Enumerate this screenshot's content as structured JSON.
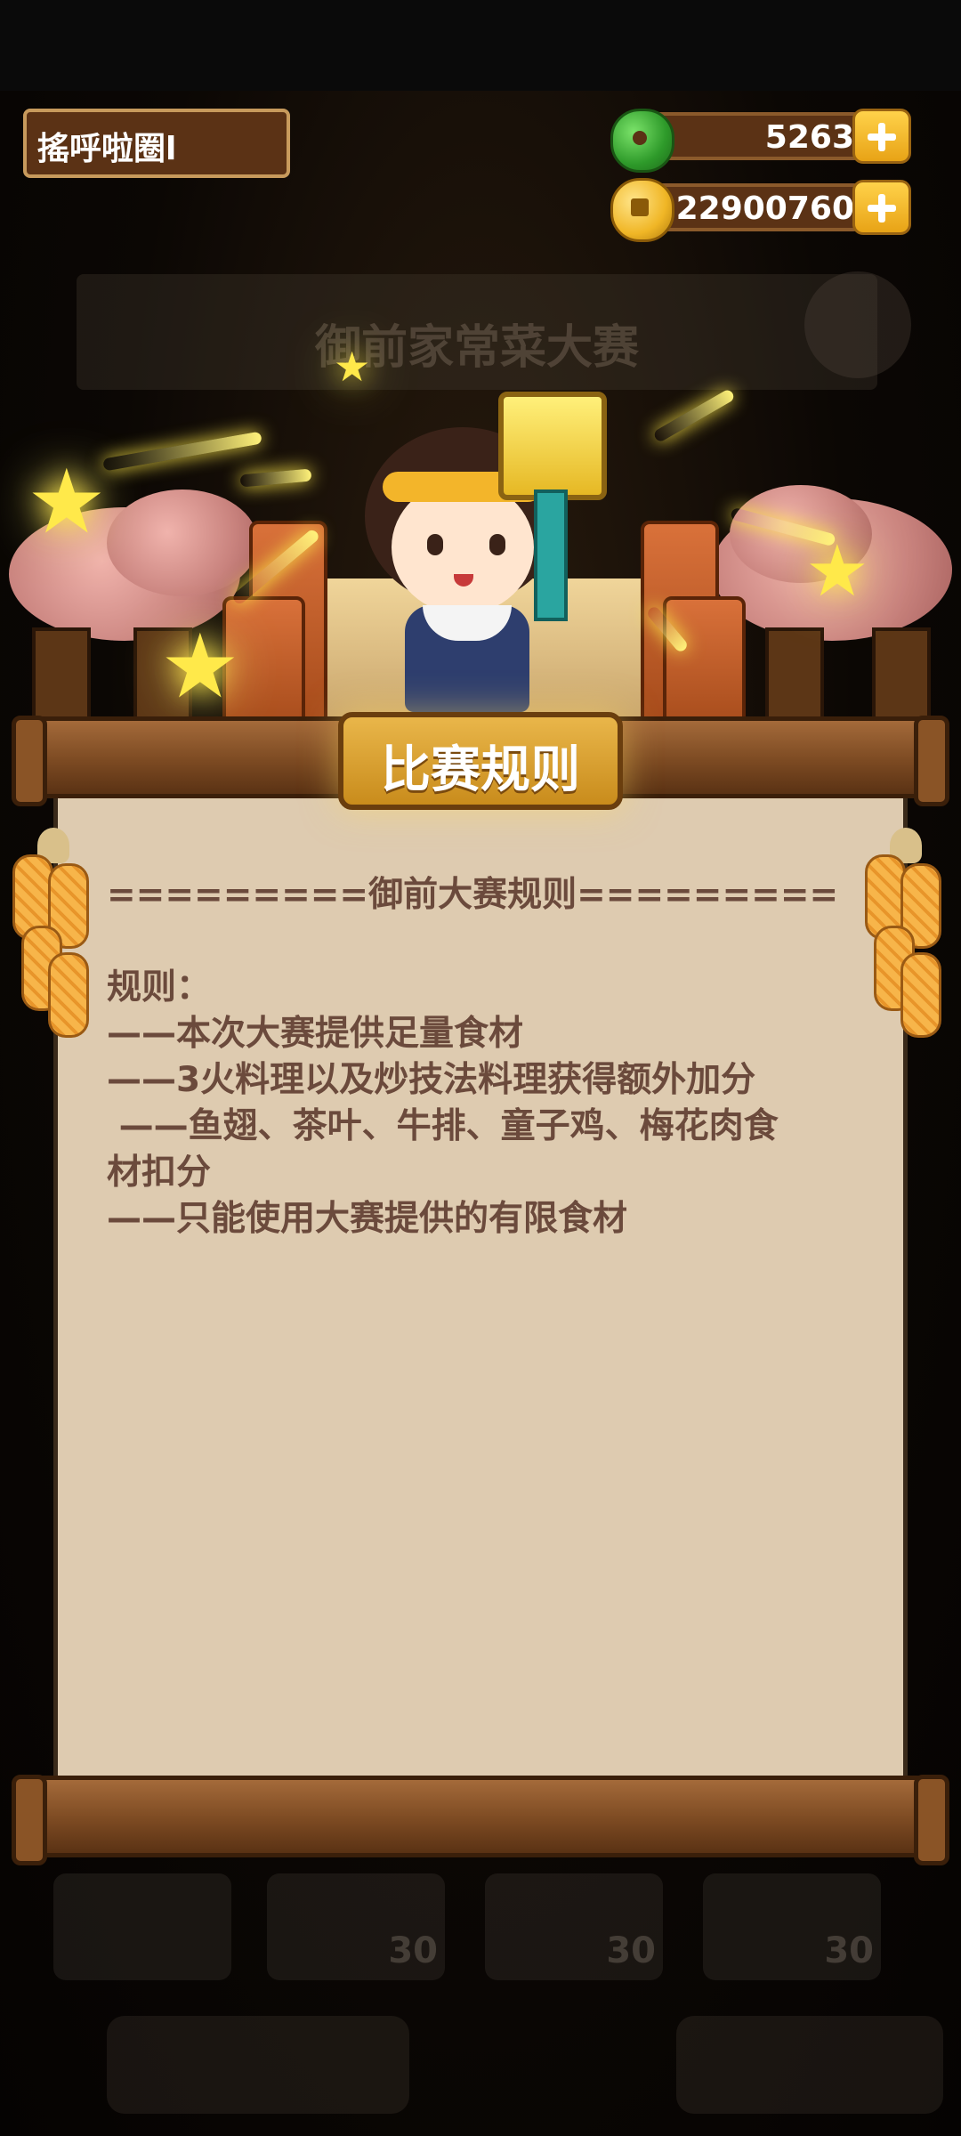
{
  "player": {
    "name": "搖呼啦圈l"
  },
  "currency": {
    "jade": {
      "value": "5263",
      "icon": "jade-icon"
    },
    "coins": {
      "value": "22900760",
      "icon": "coin-icon"
    }
  },
  "background": {
    "banner_text": "御前家常菜大赛",
    "slots": [
      "30",
      "30",
      "30"
    ]
  },
  "rules_panel": {
    "title": "比赛规则",
    "lines": [
      "=========御前大赛规则=========",
      "",
      "规则：",
      "——本次大赛提供足量食材",
      "——3火料理以及炒技法料理获得额外加分",
      " ——鱼翅、茶叶、牛排、童子鸡、梅花肉食",
      "材扣分",
      "——只能使用大赛提供的有限食材"
    ]
  },
  "colors": {
    "rule_text": "#6b4a3c",
    "paper": "#decbb0",
    "plaque": "#e9b64a",
    "wood": "#7c4a22"
  }
}
